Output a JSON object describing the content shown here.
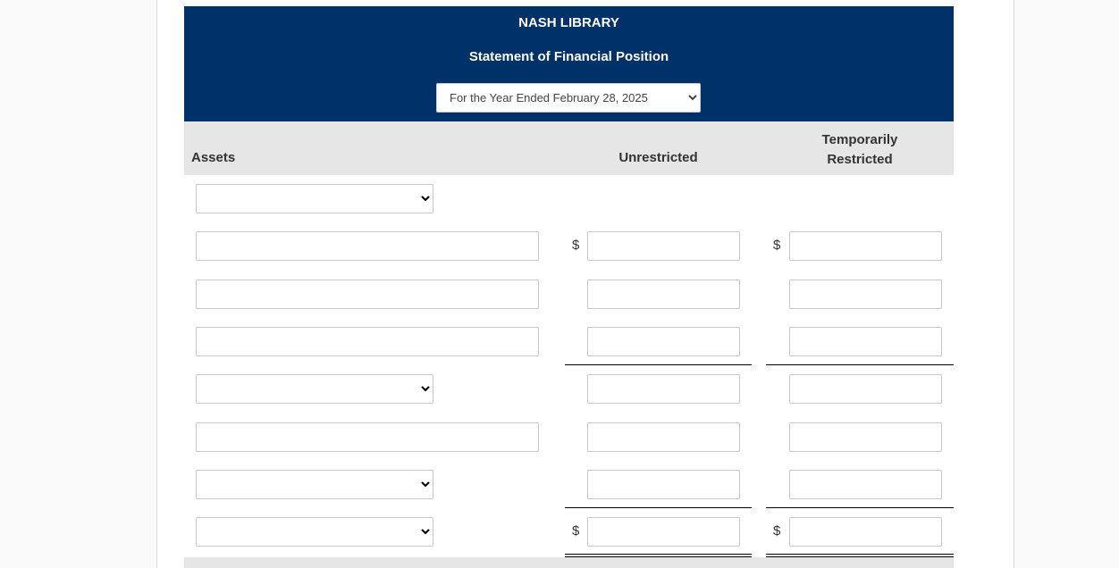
{
  "header": {
    "company": "NASH LIBRARY",
    "statement": "Statement of Financial Position",
    "period_select": {
      "selected": "For the Year Ended February 28, 2025"
    }
  },
  "columns": {
    "label": "Assets",
    "col1": "Unrestricted",
    "col2": "Temporarily Restricted"
  },
  "currency_symbol": "$",
  "rows": [
    {
      "label_type": "select",
      "label_value": "",
      "amounts": false
    },
    {
      "label_type": "text",
      "label_value": "",
      "amounts": true,
      "dollar": true,
      "unrestricted": "",
      "temporarily_restricted": ""
    },
    {
      "label_type": "text",
      "label_value": "",
      "amounts": true,
      "dollar": false,
      "unrestricted": "",
      "temporarily_restricted": ""
    },
    {
      "label_type": "text",
      "label_value": "",
      "amounts": true,
      "dollar": false,
      "unrestricted": "",
      "temporarily_restricted": "",
      "underline": "single"
    },
    {
      "label_type": "select",
      "label_value": "",
      "amounts": true,
      "dollar": false,
      "unrestricted": "",
      "temporarily_restricted": ""
    },
    {
      "label_type": "text",
      "label_value": "",
      "amounts": true,
      "dollar": false,
      "unrestricted": "",
      "temporarily_restricted": ""
    },
    {
      "label_type": "select",
      "label_value": "",
      "amounts": true,
      "dollar": false,
      "unrestricted": "",
      "temporarily_restricted": "",
      "underline": "single"
    },
    {
      "label_type": "select",
      "label_value": "",
      "amounts": true,
      "dollar": true,
      "unrestricted": "",
      "temporarily_restricted": "",
      "underline": "double"
    }
  ],
  "colors": {
    "header_bg": "#003168",
    "column_header_bg": "#e6e6e6",
    "page_bg": "#fafafa"
  }
}
